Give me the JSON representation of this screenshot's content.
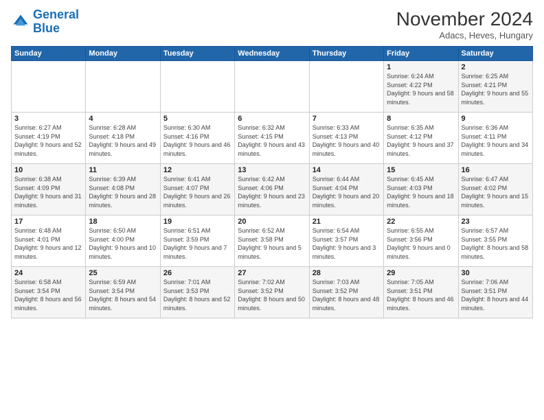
{
  "header": {
    "logo_line1": "General",
    "logo_line2": "Blue",
    "month_title": "November 2024",
    "subtitle": "Adacs, Heves, Hungary"
  },
  "weekdays": [
    "Sunday",
    "Monday",
    "Tuesday",
    "Wednesday",
    "Thursday",
    "Friday",
    "Saturday"
  ],
  "weeks": [
    [
      {
        "day": "",
        "info": ""
      },
      {
        "day": "",
        "info": ""
      },
      {
        "day": "",
        "info": ""
      },
      {
        "day": "",
        "info": ""
      },
      {
        "day": "",
        "info": ""
      },
      {
        "day": "1",
        "info": "Sunrise: 6:24 AM\nSunset: 4:22 PM\nDaylight: 9 hours and 58 minutes."
      },
      {
        "day": "2",
        "info": "Sunrise: 6:25 AM\nSunset: 4:21 PM\nDaylight: 9 hours and 55 minutes."
      }
    ],
    [
      {
        "day": "3",
        "info": "Sunrise: 6:27 AM\nSunset: 4:19 PM\nDaylight: 9 hours and 52 minutes."
      },
      {
        "day": "4",
        "info": "Sunrise: 6:28 AM\nSunset: 4:18 PM\nDaylight: 9 hours and 49 minutes."
      },
      {
        "day": "5",
        "info": "Sunrise: 6:30 AM\nSunset: 4:16 PM\nDaylight: 9 hours and 46 minutes."
      },
      {
        "day": "6",
        "info": "Sunrise: 6:32 AM\nSunset: 4:15 PM\nDaylight: 9 hours and 43 minutes."
      },
      {
        "day": "7",
        "info": "Sunrise: 6:33 AM\nSunset: 4:13 PM\nDaylight: 9 hours and 40 minutes."
      },
      {
        "day": "8",
        "info": "Sunrise: 6:35 AM\nSunset: 4:12 PM\nDaylight: 9 hours and 37 minutes."
      },
      {
        "day": "9",
        "info": "Sunrise: 6:36 AM\nSunset: 4:11 PM\nDaylight: 9 hours and 34 minutes."
      }
    ],
    [
      {
        "day": "10",
        "info": "Sunrise: 6:38 AM\nSunset: 4:09 PM\nDaylight: 9 hours and 31 minutes."
      },
      {
        "day": "11",
        "info": "Sunrise: 6:39 AM\nSunset: 4:08 PM\nDaylight: 9 hours and 28 minutes."
      },
      {
        "day": "12",
        "info": "Sunrise: 6:41 AM\nSunset: 4:07 PM\nDaylight: 9 hours and 26 minutes."
      },
      {
        "day": "13",
        "info": "Sunrise: 6:42 AM\nSunset: 4:06 PM\nDaylight: 9 hours and 23 minutes."
      },
      {
        "day": "14",
        "info": "Sunrise: 6:44 AM\nSunset: 4:04 PM\nDaylight: 9 hours and 20 minutes."
      },
      {
        "day": "15",
        "info": "Sunrise: 6:45 AM\nSunset: 4:03 PM\nDaylight: 9 hours and 18 minutes."
      },
      {
        "day": "16",
        "info": "Sunrise: 6:47 AM\nSunset: 4:02 PM\nDaylight: 9 hours and 15 minutes."
      }
    ],
    [
      {
        "day": "17",
        "info": "Sunrise: 6:48 AM\nSunset: 4:01 PM\nDaylight: 9 hours and 12 minutes."
      },
      {
        "day": "18",
        "info": "Sunrise: 6:50 AM\nSunset: 4:00 PM\nDaylight: 9 hours and 10 minutes."
      },
      {
        "day": "19",
        "info": "Sunrise: 6:51 AM\nSunset: 3:59 PM\nDaylight: 9 hours and 7 minutes."
      },
      {
        "day": "20",
        "info": "Sunrise: 6:52 AM\nSunset: 3:58 PM\nDaylight: 9 hours and 5 minutes."
      },
      {
        "day": "21",
        "info": "Sunrise: 6:54 AM\nSunset: 3:57 PM\nDaylight: 9 hours and 3 minutes."
      },
      {
        "day": "22",
        "info": "Sunrise: 6:55 AM\nSunset: 3:56 PM\nDaylight: 9 hours and 0 minutes."
      },
      {
        "day": "23",
        "info": "Sunrise: 6:57 AM\nSunset: 3:55 PM\nDaylight: 8 hours and 58 minutes."
      }
    ],
    [
      {
        "day": "24",
        "info": "Sunrise: 6:58 AM\nSunset: 3:54 PM\nDaylight: 8 hours and 56 minutes."
      },
      {
        "day": "25",
        "info": "Sunrise: 6:59 AM\nSunset: 3:54 PM\nDaylight: 8 hours and 54 minutes."
      },
      {
        "day": "26",
        "info": "Sunrise: 7:01 AM\nSunset: 3:53 PM\nDaylight: 8 hours and 52 minutes."
      },
      {
        "day": "27",
        "info": "Sunrise: 7:02 AM\nSunset: 3:52 PM\nDaylight: 8 hours and 50 minutes."
      },
      {
        "day": "28",
        "info": "Sunrise: 7:03 AM\nSunset: 3:52 PM\nDaylight: 8 hours and 48 minutes."
      },
      {
        "day": "29",
        "info": "Sunrise: 7:05 AM\nSunset: 3:51 PM\nDaylight: 8 hours and 46 minutes."
      },
      {
        "day": "30",
        "info": "Sunrise: 7:06 AM\nSunset: 3:51 PM\nDaylight: 8 hours and 44 minutes."
      }
    ]
  ]
}
